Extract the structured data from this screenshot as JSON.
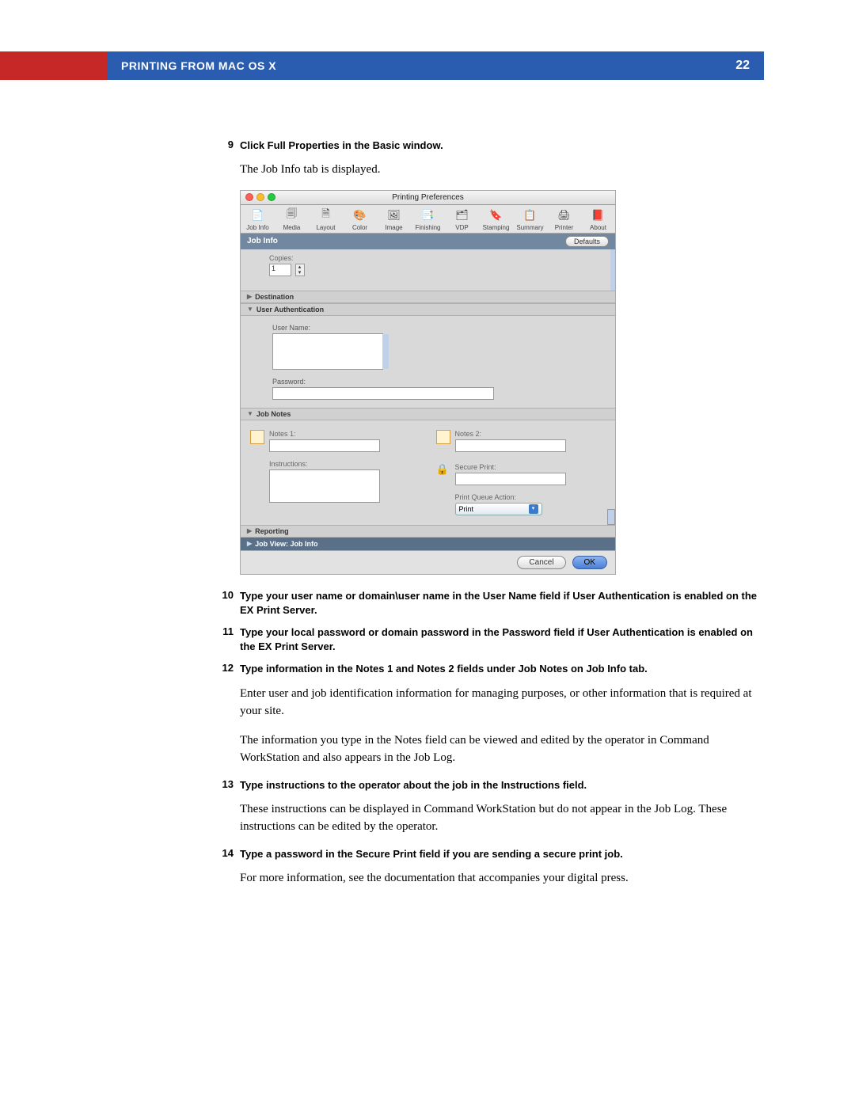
{
  "header": {
    "title": "PRINTING FROM MAC OS X",
    "page_number": "22"
  },
  "steps": {
    "s9": {
      "num": "9",
      "heading": "Click Full Properties in the Basic window.",
      "body": "The Job Info tab is displayed."
    },
    "s10": {
      "num": "10",
      "heading": "Type your user name or domain\\user name in the User Name field if User Authentication is enabled on the EX Print Server."
    },
    "s11": {
      "num": "11",
      "heading": "Type your local password or domain password in the Password field if User Authentication is enabled on the EX Print Server."
    },
    "s12": {
      "num": "12",
      "heading": "Type information in the Notes 1 and Notes 2 fields under Job Notes on Job Info tab.",
      "body1": "Enter user and job identification information for managing purposes, or other information that is required at your site.",
      "body2": "The information you type in the Notes field can be viewed and edited by the operator in Command WorkStation and also appears in the Job Log."
    },
    "s13": {
      "num": "13",
      "heading": "Type instructions to the operator about the job in the Instructions field.",
      "body": "These instructions can be displayed in Command WorkStation but do not appear in the Job Log. These instructions can be edited by the operator."
    },
    "s14": {
      "num": "14",
      "heading": "Type a password in the Secure Print field if you are sending a secure print job.",
      "body": "For more information, see the documentation that accompanies your digital press."
    }
  },
  "dialog": {
    "title": "Printing Preferences",
    "tabs": [
      "Job Info",
      "Media",
      "Layout",
      "Color",
      "Image",
      "Finishing",
      "VDP",
      "Stamping",
      "Summary",
      "Printer",
      "About"
    ],
    "section_title": "Job Info",
    "defaults_btn": "Defaults",
    "copies_label": "Copies:",
    "copies_value": "1",
    "destination_label": "Destination",
    "user_auth_label": "User Authentication",
    "username_label": "User Name:",
    "password_label": "Password:",
    "job_notes_label": "Job Notes",
    "notes1_label": "Notes 1:",
    "notes2_label": "Notes 2:",
    "instructions_label": "Instructions:",
    "secure_print_label": "Secure Print:",
    "print_queue_action_label": "Print Queue Action:",
    "print_queue_action_value": "Print",
    "reporting_label": "Reporting",
    "job_view_label": "Job View: Job Info",
    "cancel_btn": "Cancel",
    "ok_btn": "OK"
  }
}
